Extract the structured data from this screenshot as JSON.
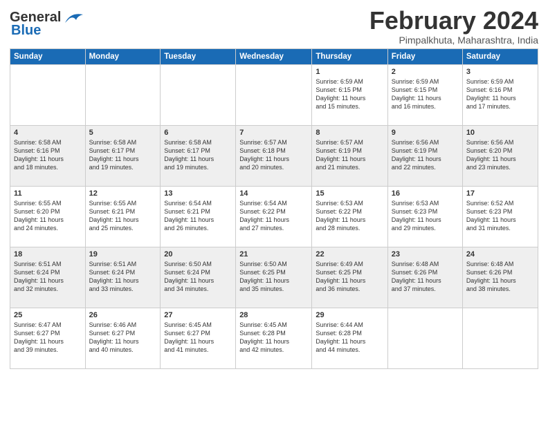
{
  "header": {
    "logo_line1": "General",
    "logo_line2": "Blue",
    "month_title": "February 2024",
    "subtitle": "Pimpalkhuta, Maharashtra, India"
  },
  "weekdays": [
    "Sunday",
    "Monday",
    "Tuesday",
    "Wednesday",
    "Thursday",
    "Friday",
    "Saturday"
  ],
  "weeks": [
    [
      {
        "day": "",
        "info": ""
      },
      {
        "day": "",
        "info": ""
      },
      {
        "day": "",
        "info": ""
      },
      {
        "day": "",
        "info": ""
      },
      {
        "day": "1",
        "info": "Sunrise: 6:59 AM\nSunset: 6:15 PM\nDaylight: 11 hours\nand 15 minutes."
      },
      {
        "day": "2",
        "info": "Sunrise: 6:59 AM\nSunset: 6:15 PM\nDaylight: 11 hours\nand 16 minutes."
      },
      {
        "day": "3",
        "info": "Sunrise: 6:59 AM\nSunset: 6:16 PM\nDaylight: 11 hours\nand 17 minutes."
      }
    ],
    [
      {
        "day": "4",
        "info": "Sunrise: 6:58 AM\nSunset: 6:16 PM\nDaylight: 11 hours\nand 18 minutes."
      },
      {
        "day": "5",
        "info": "Sunrise: 6:58 AM\nSunset: 6:17 PM\nDaylight: 11 hours\nand 19 minutes."
      },
      {
        "day": "6",
        "info": "Sunrise: 6:58 AM\nSunset: 6:17 PM\nDaylight: 11 hours\nand 19 minutes."
      },
      {
        "day": "7",
        "info": "Sunrise: 6:57 AM\nSunset: 6:18 PM\nDaylight: 11 hours\nand 20 minutes."
      },
      {
        "day": "8",
        "info": "Sunrise: 6:57 AM\nSunset: 6:19 PM\nDaylight: 11 hours\nand 21 minutes."
      },
      {
        "day": "9",
        "info": "Sunrise: 6:56 AM\nSunset: 6:19 PM\nDaylight: 11 hours\nand 22 minutes."
      },
      {
        "day": "10",
        "info": "Sunrise: 6:56 AM\nSunset: 6:20 PM\nDaylight: 11 hours\nand 23 minutes."
      }
    ],
    [
      {
        "day": "11",
        "info": "Sunrise: 6:55 AM\nSunset: 6:20 PM\nDaylight: 11 hours\nand 24 minutes."
      },
      {
        "day": "12",
        "info": "Sunrise: 6:55 AM\nSunset: 6:21 PM\nDaylight: 11 hours\nand 25 minutes."
      },
      {
        "day": "13",
        "info": "Sunrise: 6:54 AM\nSunset: 6:21 PM\nDaylight: 11 hours\nand 26 minutes."
      },
      {
        "day": "14",
        "info": "Sunrise: 6:54 AM\nSunset: 6:22 PM\nDaylight: 11 hours\nand 27 minutes."
      },
      {
        "day": "15",
        "info": "Sunrise: 6:53 AM\nSunset: 6:22 PM\nDaylight: 11 hours\nand 28 minutes."
      },
      {
        "day": "16",
        "info": "Sunrise: 6:53 AM\nSunset: 6:23 PM\nDaylight: 11 hours\nand 29 minutes."
      },
      {
        "day": "17",
        "info": "Sunrise: 6:52 AM\nSunset: 6:23 PM\nDaylight: 11 hours\nand 31 minutes."
      }
    ],
    [
      {
        "day": "18",
        "info": "Sunrise: 6:51 AM\nSunset: 6:24 PM\nDaylight: 11 hours\nand 32 minutes."
      },
      {
        "day": "19",
        "info": "Sunrise: 6:51 AM\nSunset: 6:24 PM\nDaylight: 11 hours\nand 33 minutes."
      },
      {
        "day": "20",
        "info": "Sunrise: 6:50 AM\nSunset: 6:24 PM\nDaylight: 11 hours\nand 34 minutes."
      },
      {
        "day": "21",
        "info": "Sunrise: 6:50 AM\nSunset: 6:25 PM\nDaylight: 11 hours\nand 35 minutes."
      },
      {
        "day": "22",
        "info": "Sunrise: 6:49 AM\nSunset: 6:25 PM\nDaylight: 11 hours\nand 36 minutes."
      },
      {
        "day": "23",
        "info": "Sunrise: 6:48 AM\nSunset: 6:26 PM\nDaylight: 11 hours\nand 37 minutes."
      },
      {
        "day": "24",
        "info": "Sunrise: 6:48 AM\nSunset: 6:26 PM\nDaylight: 11 hours\nand 38 minutes."
      }
    ],
    [
      {
        "day": "25",
        "info": "Sunrise: 6:47 AM\nSunset: 6:27 PM\nDaylight: 11 hours\nand 39 minutes."
      },
      {
        "day": "26",
        "info": "Sunrise: 6:46 AM\nSunset: 6:27 PM\nDaylight: 11 hours\nand 40 minutes."
      },
      {
        "day": "27",
        "info": "Sunrise: 6:45 AM\nSunset: 6:27 PM\nDaylight: 11 hours\nand 41 minutes."
      },
      {
        "day": "28",
        "info": "Sunrise: 6:45 AM\nSunset: 6:28 PM\nDaylight: 11 hours\nand 42 minutes."
      },
      {
        "day": "29",
        "info": "Sunrise: 6:44 AM\nSunset: 6:28 PM\nDaylight: 11 hours\nand 44 minutes."
      },
      {
        "day": "",
        "info": ""
      },
      {
        "day": "",
        "info": ""
      }
    ]
  ]
}
